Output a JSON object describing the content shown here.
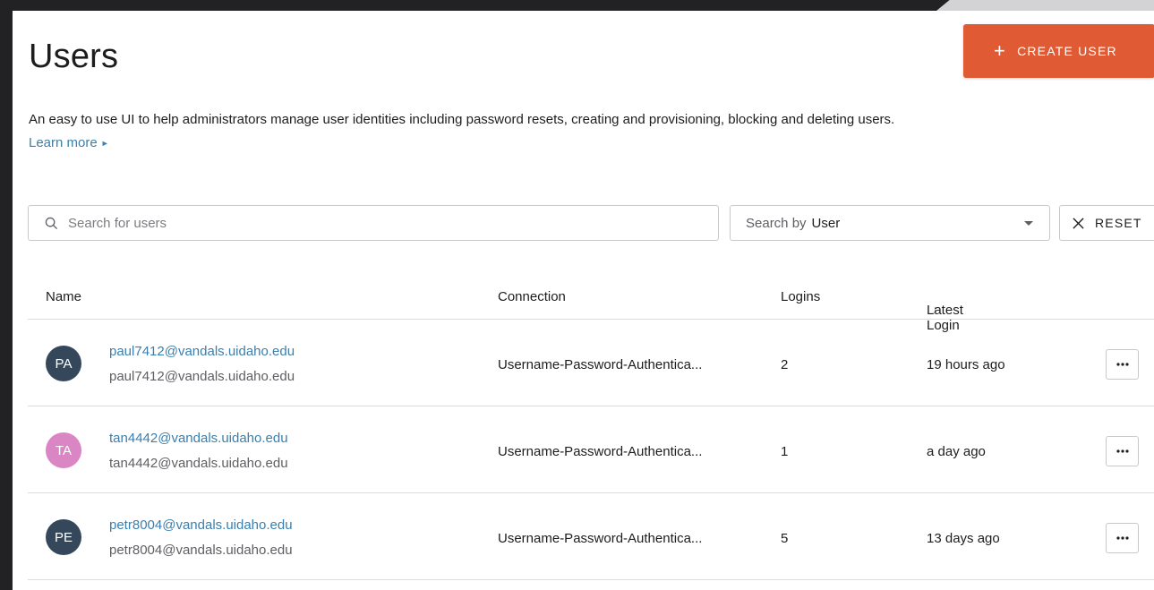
{
  "header": {
    "title": "Users",
    "create_button_label": "CREATE USER",
    "create_icon": "plus-icon"
  },
  "intro": {
    "description": "An easy to use UI to help administrators manage user identities including password resets, creating and provisioning, blocking and deleting users.",
    "learn_more": "Learn more"
  },
  "filters": {
    "search_placeholder": "Search for users",
    "search_value": "",
    "search_by_label": "Search by",
    "search_by_value": "User",
    "reset_label": "RESET"
  },
  "table": {
    "columns": {
      "name": "Name",
      "connection": "Connection",
      "logins": "Logins",
      "latest_login": "Latest Login"
    },
    "rows": [
      {
        "initials": "PA",
        "avatar_color": "#34475b",
        "email": "paul7412@vandals.uidaho.edu",
        "username": "paul7412@vandals.uidaho.edu",
        "connection": "Username-Password-Authentica...",
        "logins": "2",
        "latest_login": "19 hours ago"
      },
      {
        "initials": "TA",
        "avatar_color": "#db86c4",
        "email": "tan4442@vandals.uidaho.edu",
        "username": "tan4442@vandals.uidaho.edu",
        "connection": "Username-Password-Authentica...",
        "logins": "1",
        "latest_login": "a day ago"
      },
      {
        "initials": "PE",
        "avatar_color": "#34475b",
        "email": "petr8004@vandals.uidaho.edu",
        "username": "petr8004@vandals.uidaho.edu",
        "connection": "Username-Password-Authentica...",
        "logins": "5",
        "latest_login": "13 days ago"
      }
    ]
  },
  "colors": {
    "accent": "#e05a33",
    "link": "#3a7fad"
  }
}
